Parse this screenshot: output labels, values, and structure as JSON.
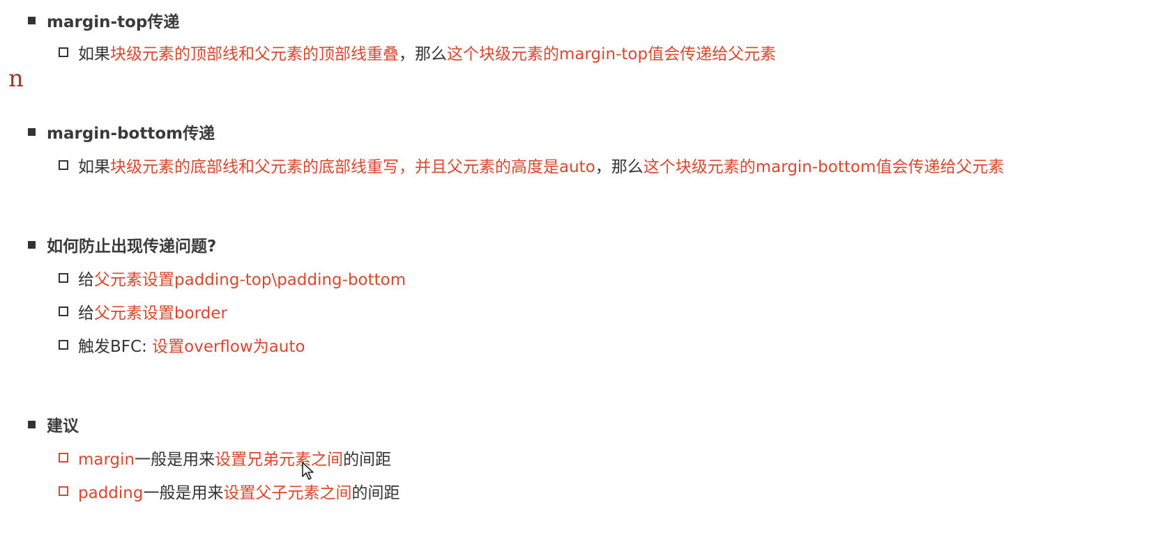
{
  "stray_char": "n",
  "sections": [
    {
      "heading": "margin-top传递",
      "items": [
        {
          "parts": [
            {
              "t": "如果",
              "c": "k"
            },
            {
              "t": "块级元素的顶部线和父元素的顶部线重叠",
              "c": "r"
            },
            {
              "t": "，那么",
              "c": "k"
            },
            {
              "t": "这个块级元素的margin-top值会传递给父元素",
              "c": "r"
            }
          ]
        }
      ]
    },
    {
      "heading": "margin-bottom传递",
      "items": [
        {
          "parts": [
            {
              "t": "如果",
              "c": "k"
            },
            {
              "t": "块级元素的底部线和父元素的底部线重写，并且父元素的高度是auto",
              "c": "r"
            },
            {
              "t": "，那么",
              "c": "k"
            },
            {
              "t": "这个块级元素的margin-bottom值会传递给父元素",
              "c": "r"
            }
          ]
        }
      ]
    },
    {
      "heading": "如何防止出现传递问题?",
      "items": [
        {
          "parts": [
            {
              "t": "给",
              "c": "k"
            },
            {
              "t": "父元素设置padding-top\\padding-bottom",
              "c": "r"
            }
          ]
        },
        {
          "parts": [
            {
              "t": "给",
              "c": "k"
            },
            {
              "t": "父元素设置border",
              "c": "r"
            }
          ]
        },
        {
          "parts": [
            {
              "t": "触发BFC: ",
              "c": "k"
            },
            {
              "t": "设置overflow为auto",
              "c": "r"
            }
          ]
        }
      ]
    },
    {
      "heading": "建议",
      "items": [
        {
          "red_box": true,
          "parts": [
            {
              "t": "margin",
              "c": "r"
            },
            {
              "t": "一般是用来",
              "c": "k"
            },
            {
              "t": "设置兄弟元素之间",
              "c": "r"
            },
            {
              "t": "的间距",
              "c": "k"
            }
          ]
        },
        {
          "red_box": true,
          "parts": [
            {
              "t": "padding",
              "c": "r"
            },
            {
              "t": "一般是用来",
              "c": "k"
            },
            {
              "t": "设置父子元素之间",
              "c": "r"
            },
            {
              "t": "的间距",
              "c": "k"
            }
          ]
        }
      ]
    }
  ],
  "colors": {
    "text": "#333333",
    "accent": "#d9472f"
  }
}
